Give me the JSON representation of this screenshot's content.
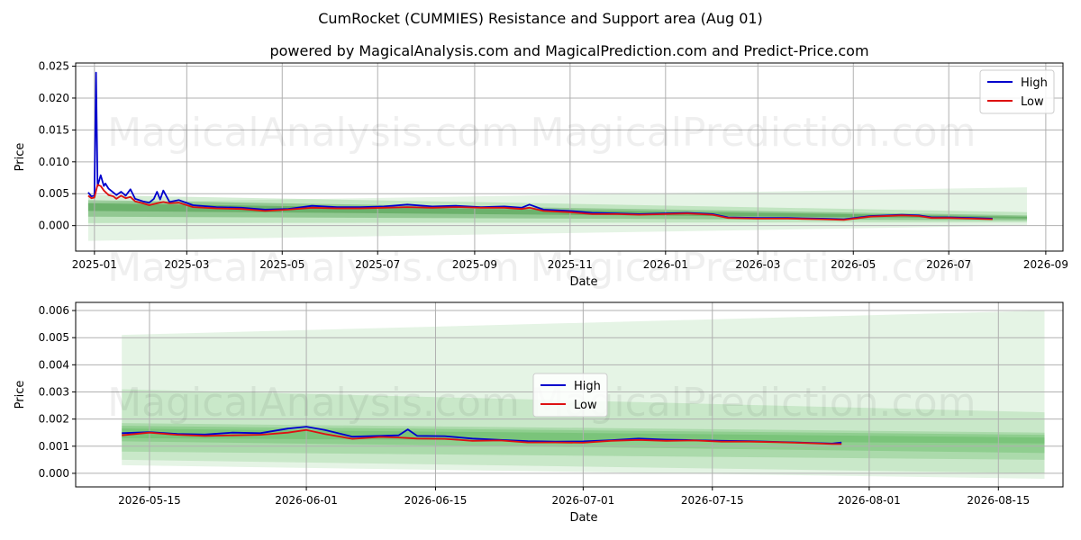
{
  "title": "CumRocket (CUMMIES) Resistance and Support area (Aug 01)",
  "subtitle": "powered by MagicalAnalysis.com and MagicalPrediction.com and Predict-Price.com",
  "watermarks": [
    "MagicalAnalysis.com",
    "MagicalPrediction.com"
  ],
  "colors": {
    "high": "#0000cc",
    "low": "#dd1111",
    "band_light": "#5cb85c",
    "band_dark": "#2e8b2e"
  },
  "chart_data": [
    {
      "type": "line",
      "xlabel": "Date",
      "ylabel": "Price",
      "xlim": [
        "2024-12-20",
        "2026-09-12"
      ],
      "ylim": [
        -0.004,
        0.0255
      ],
      "x_ticks": [
        "2025-01",
        "2025-03",
        "2025-05",
        "2025-07",
        "2025-09",
        "2025-11",
        "2026-01",
        "2026-03",
        "2026-05",
        "2026-07",
        "2026-09"
      ],
      "x_tick_dates": [
        "2025-01-01",
        "2025-03-01",
        "2025-05-01",
        "2025-07-01",
        "2025-09-01",
        "2025-11-01",
        "2026-01-01",
        "2026-03-01",
        "2026-05-01",
        "2026-07-01",
        "2026-09-01"
      ],
      "y_ticks": [
        "0.000",
        "0.005",
        "0.010",
        "0.015",
        "0.020",
        "0.025"
      ],
      "y_tick_values": [
        0,
        0.005,
        0.01,
        0.015,
        0.02,
        0.025
      ],
      "grid": true,
      "legend": "top-right",
      "series": [
        {
          "name": "High",
          "x": [
            "2024-12-28",
            "2024-12-30",
            "2025-01-01",
            "2025-01-02",
            "2025-01-03",
            "2025-01-05",
            "2025-01-07",
            "2025-01-08",
            "2025-01-10",
            "2025-01-13",
            "2025-01-15",
            "2025-01-18",
            "2025-01-21",
            "2025-01-24",
            "2025-01-27",
            "2025-02-01",
            "2025-02-05",
            "2025-02-08",
            "2025-02-10",
            "2025-02-12",
            "2025-02-14",
            "2025-02-18",
            "2025-02-24",
            "2025-03-05",
            "2025-03-20",
            "2025-04-05",
            "2025-04-20",
            "2025-05-05",
            "2025-05-20",
            "2025-06-05",
            "2025-06-20",
            "2025-07-05",
            "2025-07-20",
            "2025-08-05",
            "2025-08-20",
            "2025-09-05",
            "2025-09-20",
            "2025-10-01",
            "2025-10-06",
            "2025-10-15",
            "2025-11-01",
            "2025-11-15",
            "2025-12-01",
            "2025-12-15",
            "2026-01-01",
            "2026-01-15",
            "2026-01-31",
            "2026-02-10",
            "2026-03-01",
            "2026-03-20",
            "2026-04-10",
            "2026-04-25",
            "2026-05-12",
            "2026-06-01",
            "2026-06-12",
            "2026-06-20",
            "2026-07-01",
            "2026-07-15",
            "2026-07-29"
          ],
          "values": [
            0.0052,
            0.0046,
            0.0047,
            0.024,
            0.0062,
            0.0079,
            0.0062,
            0.0066,
            0.0058,
            0.0052,
            0.0048,
            0.0053,
            0.0047,
            0.0057,
            0.0042,
            0.0038,
            0.0036,
            0.0042,
            0.0053,
            0.0041,
            0.0055,
            0.0037,
            0.004,
            0.0032,
            0.0029,
            0.0028,
            0.0025,
            0.0026,
            0.0031,
            0.0029,
            0.0029,
            0.003,
            0.0033,
            0.003,
            0.0031,
            0.0029,
            0.003,
            0.0028,
            0.0033,
            0.0025,
            0.0023,
            0.002,
            0.0019,
            0.0018,
            0.0019,
            0.002,
            0.0018,
            0.0013,
            0.0012,
            0.0012,
            0.0011,
            0.001,
            0.0015,
            0.0017,
            0.0016,
            0.0013,
            0.0013,
            0.0012,
            0.0011
          ]
        },
        {
          "name": "Low",
          "x": [
            "2024-12-28",
            "2024-12-30",
            "2025-01-01",
            "2025-01-03",
            "2025-01-05",
            "2025-01-07",
            "2025-01-10",
            "2025-01-13",
            "2025-01-15",
            "2025-01-18",
            "2025-01-21",
            "2025-01-24",
            "2025-01-27",
            "2025-02-01",
            "2025-02-05",
            "2025-02-10",
            "2025-02-14",
            "2025-02-18",
            "2025-02-24",
            "2025-03-05",
            "2025-03-20",
            "2025-04-05",
            "2025-04-20",
            "2025-05-05",
            "2025-05-20",
            "2025-06-05",
            "2025-06-20",
            "2025-07-05",
            "2025-07-20",
            "2025-08-05",
            "2025-08-20",
            "2025-09-05",
            "2025-09-20",
            "2025-10-01",
            "2025-10-06",
            "2025-10-15",
            "2025-11-01",
            "2025-11-15",
            "2025-12-01",
            "2025-12-15",
            "2026-01-01",
            "2026-01-15",
            "2026-01-31",
            "2026-02-10",
            "2026-03-01",
            "2026-03-20",
            "2026-04-10",
            "2026-04-25",
            "2026-05-12",
            "2026-06-01",
            "2026-06-12",
            "2026-06-20",
            "2026-07-01",
            "2026-07-15",
            "2026-07-29"
          ],
          "values": [
            0.0047,
            0.0043,
            0.0044,
            0.0064,
            0.0062,
            0.0055,
            0.0048,
            0.0046,
            0.0042,
            0.0047,
            0.0043,
            0.0045,
            0.0038,
            0.0035,
            0.0032,
            0.0035,
            0.0037,
            0.0035,
            0.0036,
            0.0029,
            0.0027,
            0.0026,
            0.0023,
            0.0025,
            0.0028,
            0.0027,
            0.0027,
            0.0028,
            0.0029,
            0.0028,
            0.0029,
            0.0028,
            0.0028,
            0.0026,
            0.0028,
            0.0023,
            0.0021,
            0.0018,
            0.0018,
            0.0017,
            0.0018,
            0.0019,
            0.0017,
            0.0012,
            0.0011,
            0.0011,
            0.001,
            0.0009,
            0.0014,
            0.0016,
            0.0015,
            0.0012,
            0.0012,
            0.0011,
            0.001
          ]
        }
      ]
    },
    {
      "type": "line",
      "xlabel": "Date",
      "ylabel": "Price",
      "xlim": [
        "2026-05-07",
        "2026-08-22"
      ],
      "ylim": [
        -0.0005,
        0.0063
      ],
      "x_ticks": [
        "2026-05-15",
        "2026-06-01",
        "2026-06-15",
        "2026-07-01",
        "2026-07-15",
        "2026-08-01",
        "2026-08-15"
      ],
      "y_ticks": [
        "0.000",
        "0.001",
        "0.002",
        "0.003",
        "0.004",
        "0.005",
        "0.006"
      ],
      "y_tick_values": [
        0,
        0.001,
        0.002,
        0.003,
        0.004,
        0.005,
        0.006
      ],
      "grid": true,
      "legend": "center",
      "series": [
        {
          "name": "High",
          "x": [
            "2026-05-12",
            "2026-05-15",
            "2026-05-18",
            "2026-05-21",
            "2026-05-24",
            "2026-05-27",
            "2026-05-30",
            "2026-06-01",
            "2026-06-03",
            "2026-06-06",
            "2026-06-09",
            "2026-06-11",
            "2026-06-12",
            "2026-06-13",
            "2026-06-16",
            "2026-06-19",
            "2026-06-22",
            "2026-06-25",
            "2026-06-28",
            "2026-07-01",
            "2026-07-04",
            "2026-07-07",
            "2026-07-10",
            "2026-07-13",
            "2026-07-16",
            "2026-07-19",
            "2026-07-22",
            "2026-07-25",
            "2026-07-28",
            "2026-07-29"
          ],
          "values": [
            0.00148,
            0.00152,
            0.00145,
            0.00143,
            0.0015,
            0.00148,
            0.00165,
            0.00172,
            0.0016,
            0.00135,
            0.00138,
            0.0014,
            0.00162,
            0.00138,
            0.00137,
            0.00128,
            0.00123,
            0.00119,
            0.00117,
            0.00118,
            0.00122,
            0.00128,
            0.00124,
            0.00122,
            0.0012,
            0.00119,
            0.00116,
            0.00113,
            0.0011,
            0.00114
          ]
        },
        {
          "name": "Low",
          "x": [
            "2026-05-12",
            "2026-05-15",
            "2026-05-18",
            "2026-05-21",
            "2026-05-24",
            "2026-05-27",
            "2026-05-30",
            "2026-06-01",
            "2026-06-03",
            "2026-06-06",
            "2026-06-09",
            "2026-06-11",
            "2026-06-12",
            "2026-06-13",
            "2026-06-16",
            "2026-06-19",
            "2026-06-22",
            "2026-06-25",
            "2026-06-28",
            "2026-07-01",
            "2026-07-04",
            "2026-07-07",
            "2026-07-10",
            "2026-07-13",
            "2026-07-16",
            "2026-07-19",
            "2026-07-22",
            "2026-07-25",
            "2026-07-28",
            "2026-07-29"
          ],
          "values": [
            0.0014,
            0.0015,
            0.00142,
            0.00138,
            0.0014,
            0.00142,
            0.0015,
            0.0016,
            0.00145,
            0.00127,
            0.00134,
            0.00132,
            0.0013,
            0.00128,
            0.00127,
            0.0012,
            0.00121,
            0.00114,
            0.00114,
            0.00113,
            0.0012,
            0.00123,
            0.0012,
            0.00121,
            0.00117,
            0.00117,
            0.00115,
            0.00112,
            0.00108,
            0.00108
          ]
        }
      ]
    }
  ]
}
